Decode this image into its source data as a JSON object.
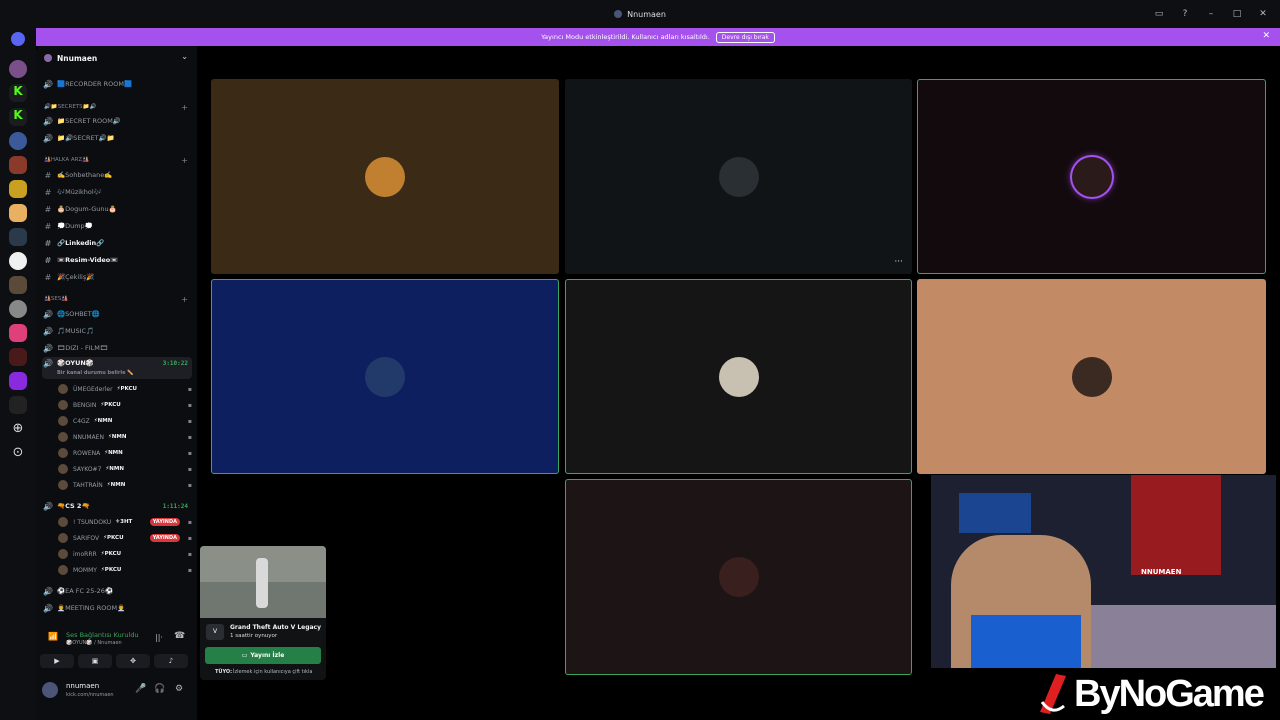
{
  "window": {
    "title": "Nnumaen"
  },
  "banner": {
    "text": "Yayıncı Modu etkinleştirildi. Kullanıcı adları kısaltıldı.",
    "button": "Devre dışı bırak"
  },
  "guild": {
    "name": "Nnumaen"
  },
  "channels": {
    "recorder": "🟦RECORDER ROOM🟦",
    "cat_secrets": "🔊📁SECRETS📁🔊",
    "secret_room": "📁SECRET ROOM🔊",
    "secret": "📁🔊SECRET🔊📁",
    "cat_halka": "🎎HALKA ARZ🎎",
    "sohbethane": "✍️Sohbethane✍️",
    "muzikhol": "🎶Müzikhol🎶",
    "dogum": "🎂Dogum-Gunu🎂",
    "dump": "💭Dump💭",
    "linkedin": "🔗Linkedin🔗",
    "resim": "📼Resim-Video📼",
    "cekilis": "🎉Çekiliş🎉",
    "cat_ses": "🎎SES🎎",
    "sohbet": "🌐SOHBET🌐",
    "music": "🎵MUSIC🎵",
    "dizi": "🎞DIZI - FILM🎞",
    "oyun": "🎲OYUN🎲",
    "oyun_timer": "3:10:22",
    "oyun_status": "Bir kanal durumu belirle ✏️",
    "cs2": "🔫CS 2🔫",
    "cs2_timer": "1:11:24",
    "eafc": "⚽EA FC 25-26⚽",
    "meeting": "👨‍💼MEETING ROOM👨‍💼"
  },
  "oyun_users": [
    {
      "name": "ÜMEGEderler",
      "tag": "⚡PKCU"
    },
    {
      "name": "BENGIN",
      "tag": "⚡PKCU"
    },
    {
      "name": "C4GZ",
      "tag": "⚡NMN"
    },
    {
      "name": "NNUMAEN",
      "tag": "⚡NMN"
    },
    {
      "name": "ROWENA",
      "tag": "⚡NMN"
    },
    {
      "name": "SAYKO#7",
      "tag": "⚡NMN"
    },
    {
      "name": "TAHTRAİN",
      "tag": "⚡NMN"
    }
  ],
  "cs_users": [
    {
      "name": "! TSUNDOKU",
      "tag": "⚜3HT",
      "live": "YAYINDA"
    },
    {
      "name": "SARIFOV",
      "tag": "⚡PKCU",
      "live": "YAYINDA"
    },
    {
      "name": "imoRRR",
      "tag": "⚡PKCU",
      "live": ""
    },
    {
      "name": "MOMMY",
      "tag": "⚡PKCU",
      "live": ""
    }
  ],
  "voice": {
    "status": "Ses Bağlantısı Kuruldu",
    "sub": "🎲OYUN🎲 / Nnumaen"
  },
  "user": {
    "name": "nnumaen",
    "sub": "kick.com/nnumaen"
  },
  "popup": {
    "game": "Grand Theft Auto V Legacy",
    "time": "1 saattir oynuyor",
    "button": "Yayını İzle",
    "tip": "İzlemek için kullanıcıya çift tıkla",
    "tip_label": "TÜYO:"
  },
  "overlay": {
    "streamer": "NNUMAEN",
    "logo": "ByNoGame"
  },
  "tiles": [
    {
      "bg": "#3b2a16"
    },
    {
      "bg": "#111417"
    },
    {
      "bg": "#130a0e"
    },
    {
      "bg": "#0d1f5e"
    },
    {
      "bg": "#151515"
    },
    {
      "bg": "#c38a66"
    },
    {
      "bg": "#1d1416"
    }
  ]
}
